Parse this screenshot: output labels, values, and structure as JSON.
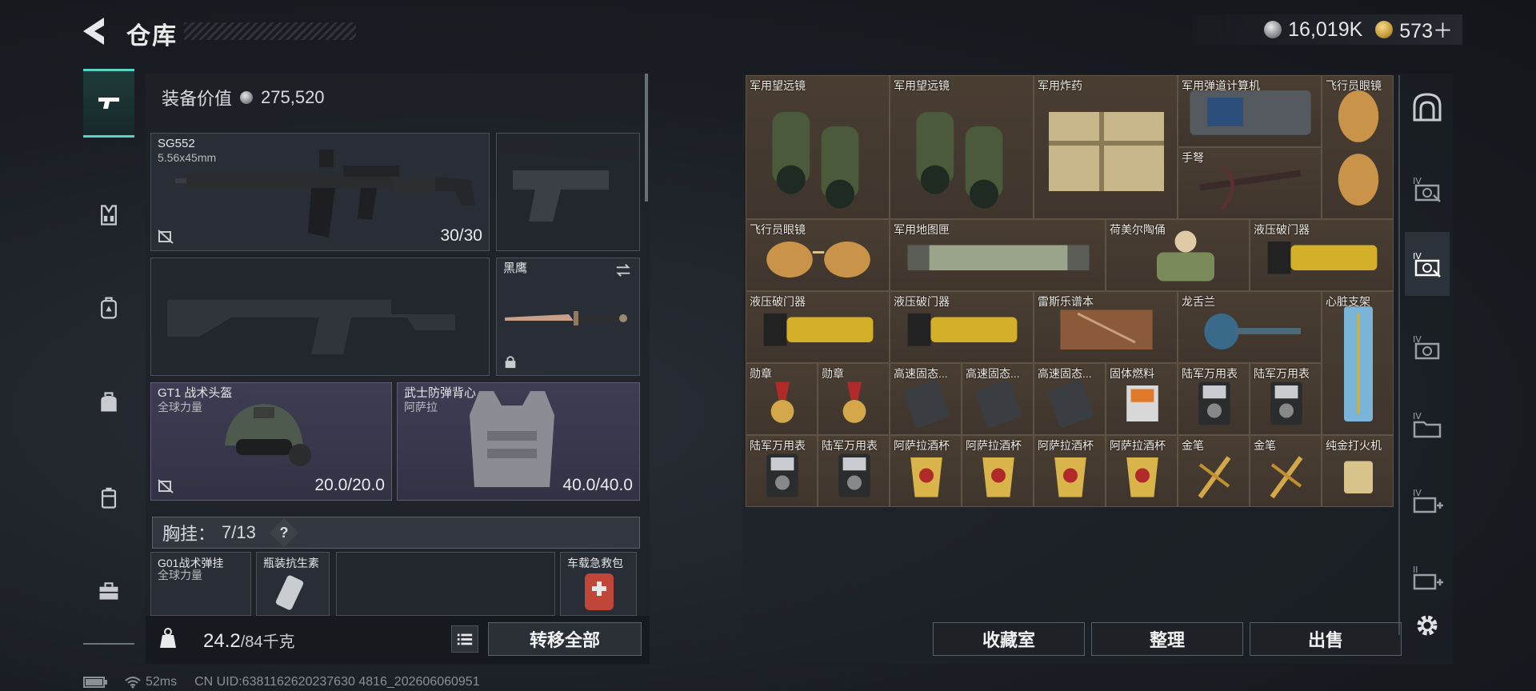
{
  "header": {
    "title": "仓库",
    "currency_silver": "16,019K",
    "currency_gold": "573＋"
  },
  "nav": [
    "weapons-icon",
    "vest-icon",
    "backpack-icon",
    "bag-icon",
    "container-icon",
    "toolbox-icon"
  ],
  "equipment": {
    "value_label": "装备价值",
    "value": "275,520",
    "primary": {
      "name": "SG552",
      "ammo": "5.56x45mm",
      "count": "30/30"
    },
    "knife": {
      "name": "黑鹰"
    },
    "helmet": {
      "name": "GT1 战术头盔",
      "brand": "全球力量",
      "durability": "20.0/20.0"
    },
    "armor": {
      "name": "武士防弹背心",
      "brand": "阿萨拉",
      "durability": "40.0/40.0"
    },
    "rig_label": "胸挂：",
    "rig_count": "7/13",
    "rig_help": "?",
    "rig_items": [
      {
        "name": "G01战术弹挂",
        "brand": "全球力量"
      },
      {
        "name": "瓶装抗生素"
      },
      {
        "name": "车载急救包"
      }
    ],
    "weight": "24.2",
    "weight_max": "/84千克",
    "transfer_all": "转移全部"
  },
  "status": {
    "ping": "52ms",
    "uid": "CN UID:6381162620237630 4816_202606060951"
  },
  "stash": {
    "items": [
      "军用望远镜",
      "军用望远镜",
      "军用炸药",
      "军用弹道计算机",
      "飞行员眼镜",
      "手弩",
      "飞行员眼镜",
      "军用地图匣",
      "荷美尔陶俑",
      "液压破门器",
      "液压破门器",
      "液压破门器",
      "雷斯乐谱本",
      "龙舌兰",
      "心脏支架",
      "勋章",
      "勋章",
      "高速固态...",
      "高速固态...",
      "高速固态...",
      "固体燃料",
      "陆军万用表",
      "陆军万用表",
      "陆军万用表",
      "陆军万用表",
      "阿萨拉酒杯",
      "阿萨拉酒杯",
      "阿萨拉酒杯",
      "阿萨拉酒杯",
      "金笔",
      "金笔",
      "纯金打火机"
    ]
  },
  "buttons": {
    "collection": "收藏室",
    "organize": "整理",
    "sell": "出售"
  }
}
